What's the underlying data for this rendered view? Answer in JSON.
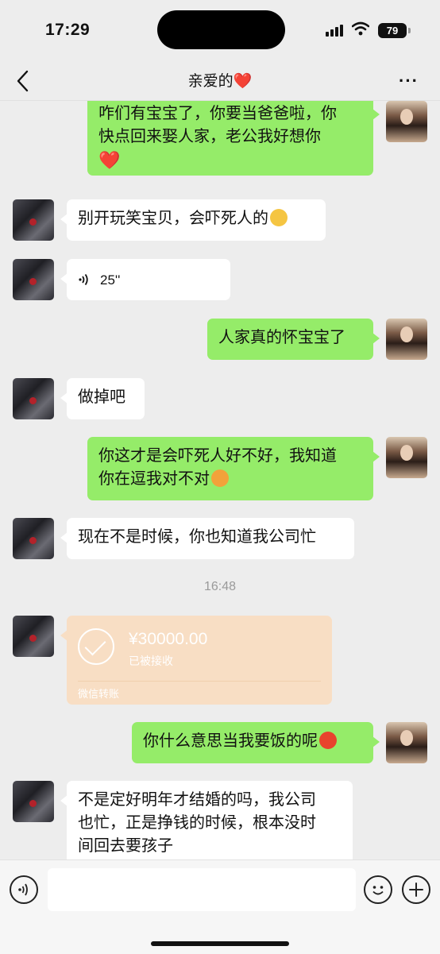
{
  "status": {
    "time": "17:29",
    "battery": "79"
  },
  "header": {
    "title": "亲爱的",
    "title_emoji": "❤️"
  },
  "messages": [
    {
      "side": "out",
      "text": "咋们有宝宝了，你要当爸爸啦，你\n快点回来娶人家，老公我好想你",
      "emoji": "❤️"
    },
    {
      "side": "in",
      "text": "别开玩笑宝贝，会吓死人的",
      "emoji": "emoji-sweat-face"
    },
    {
      "side": "in",
      "type": "voice",
      "duration": "25''"
    },
    {
      "side": "out",
      "text": "人家真的怀宝宝了"
    },
    {
      "side": "in",
      "text": "做掉吧"
    },
    {
      "side": "out",
      "text": "你这才是会吓死人好不好，我知道\n你在逗我对不对",
      "emoji": "emoji-pouting-face"
    },
    {
      "side": "in",
      "text": "现在不是时候，你也知道我公司忙"
    },
    {
      "type": "timestamp",
      "text": "16:48"
    },
    {
      "side": "in",
      "type": "transfer",
      "amount": "¥30000.00",
      "status": "已被接收",
      "label": "微信转账"
    },
    {
      "side": "out",
      "text": "你什么意思当我要饭的呢",
      "emoji": "emoji-angry-face"
    },
    {
      "side": "in",
      "text": "不是定好明年才结婚的吗，我公司\n也忙，正是挣钱的时候，根本没时\n间回去要孩子"
    }
  ],
  "colors": {
    "outgoing_bubble": "#95ec69",
    "incoming_bubble": "#ffffff",
    "transfer_card": "#f8dec4",
    "background": "#ededed"
  }
}
